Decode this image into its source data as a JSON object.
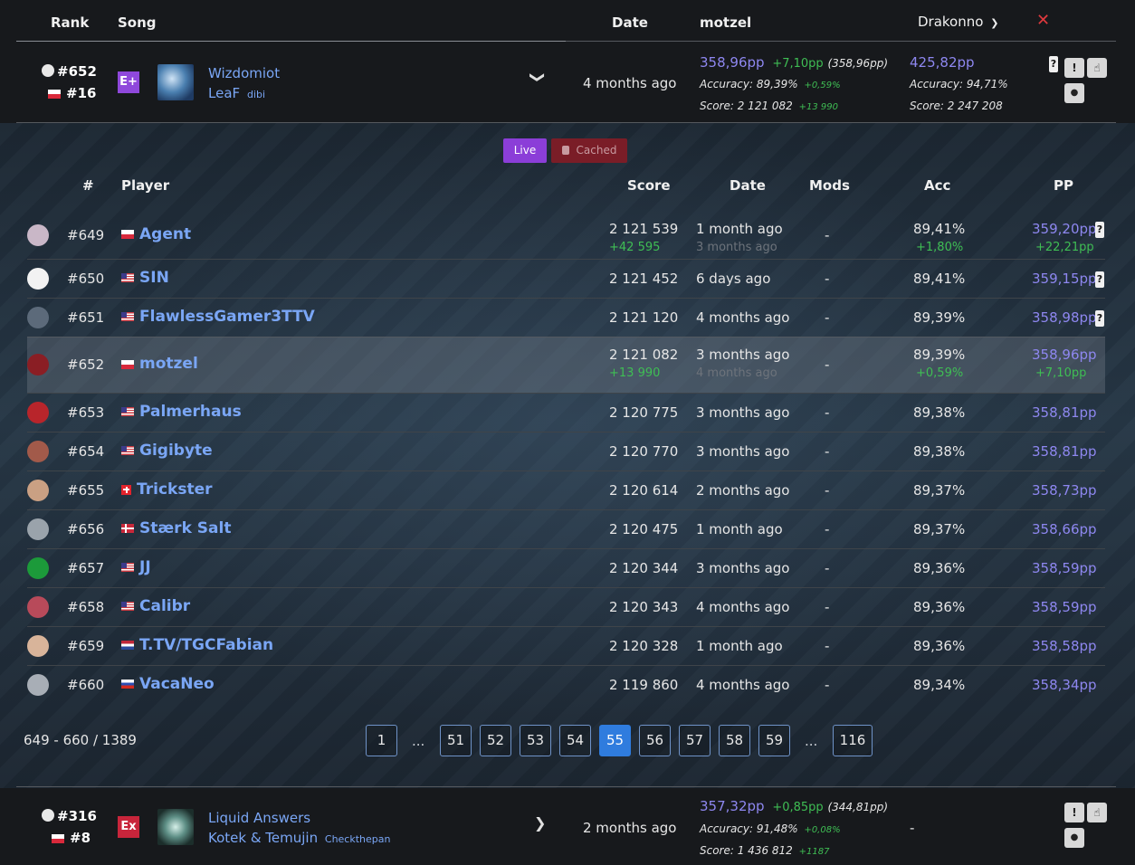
{
  "header": {
    "rank": "Rank",
    "song": "Song",
    "date": "Date",
    "player1": "motzel",
    "player2": "Drakonno",
    "close_icon": "close-x-icon"
  },
  "top_song": {
    "global_rank": "#652",
    "country_rank": "#16",
    "difficulty": "E+",
    "difficulty_color": "#8f48db",
    "title": "Wizdomiot",
    "artist": "LeaF",
    "mapper": "dibi",
    "date": "4 months ago",
    "p1": {
      "pp": "358,96pp",
      "pp_diff": "+7,10pp",
      "pp_prev": "(358,96pp)",
      "accuracy": "Accuracy: 89,39%",
      "acc_diff": "+0,59%",
      "score": "Score: 2 121 082",
      "score_diff": "+13 990"
    },
    "p2": {
      "pp": "425,82pp",
      "accuracy": "Accuracy: 94,71%",
      "score": "Score: 2 247 208"
    }
  },
  "toggle": {
    "live": "Live",
    "cached": "Cached"
  },
  "table": {
    "headers": {
      "num": "#",
      "player": "Player",
      "score": "Score",
      "date": "Date",
      "mods": "Mods",
      "acc": "Acc",
      "pp": "PP"
    },
    "rows": [
      {
        "rank": "#649",
        "flag": "pl",
        "name": "Agent",
        "score": "2 121 539",
        "score_sub": "+42 595",
        "date": "1 month ago",
        "date_sub": "3 months ago",
        "mods": "-",
        "acc": "89,41%",
        "acc_sub": "+1,80%",
        "pp": "359,20pp",
        "pp_sub": "+22,21pp",
        "q": "?"
      },
      {
        "rank": "#650",
        "flag": "us",
        "name": "SIN",
        "score": "2 121 452",
        "date": "6 days ago",
        "mods": "-",
        "acc": "89,41%",
        "pp": "359,15pp",
        "q": "?"
      },
      {
        "rank": "#651",
        "flag": "us",
        "name": "FlawlessGamer3TTV",
        "score": "2 121 120",
        "date": "4 months ago",
        "mods": "-",
        "acc": "89,39%",
        "pp": "358,98pp",
        "q": "?"
      },
      {
        "rank": "#652",
        "flag": "pl",
        "name": "motzel",
        "score": "2 121 082",
        "score_sub": "+13 990",
        "date": "3 months ago",
        "date_sub": "4 months ago",
        "mods": "-",
        "acc": "89,39%",
        "acc_sub": "+0,59%",
        "pp": "358,96pp",
        "pp_sub": "+7,10pp"
      },
      {
        "rank": "#653",
        "flag": "us",
        "name": "Palmerhaus",
        "score": "2 120 775",
        "date": "3 months ago",
        "mods": "-",
        "acc": "89,38%",
        "pp": "358,81pp"
      },
      {
        "rank": "#654",
        "flag": "us",
        "name": "Gigibyte",
        "score": "2 120 770",
        "date": "3 months ago",
        "mods": "-",
        "acc": "89,38%",
        "pp": "358,81pp"
      },
      {
        "rank": "#655",
        "flag": "ch",
        "name": "Trickster",
        "score": "2 120 614",
        "date": "2 months ago",
        "mods": "-",
        "acc": "89,37%",
        "pp": "358,73pp"
      },
      {
        "rank": "#656",
        "flag": "dk",
        "name": "Stærk Salt",
        "score": "2 120 475",
        "date": "1 month ago",
        "mods": "-",
        "acc": "89,37%",
        "pp": "358,66pp"
      },
      {
        "rank": "#657",
        "flag": "us",
        "name": "JJ",
        "score": "2 120 344",
        "date": "3 months ago",
        "mods": "-",
        "acc": "89,36%",
        "pp": "358,59pp"
      },
      {
        "rank": "#658",
        "flag": "us",
        "name": "Calibr",
        "score": "2 120 343",
        "date": "4 months ago",
        "mods": "-",
        "acc": "89,36%",
        "pp": "358,59pp"
      },
      {
        "rank": "#659",
        "flag": "nl",
        "name": "T.TV/TGCFabian",
        "score": "2 120 328",
        "date": "1 month ago",
        "mods": "-",
        "acc": "89,36%",
        "pp": "358,58pp"
      },
      {
        "rank": "#660",
        "flag": "ru",
        "name": "VacaNeo",
        "score": "2 119 860",
        "date": "4 months ago",
        "mods": "-",
        "acc": "89,34%",
        "pp": "358,34pp"
      }
    ]
  },
  "pagination": {
    "range": "649 - 660 / 1389",
    "pages": [
      "1",
      "...",
      "51",
      "52",
      "53",
      "54",
      "55",
      "56",
      "57",
      "58",
      "59",
      "...",
      "116"
    ],
    "active": "55"
  },
  "bottom_song": {
    "global_rank": "#316",
    "country_rank": "#8",
    "difficulty": "Ex",
    "difficulty_color": "#c8253b",
    "title": "Liquid Answers",
    "artist": "Kotek & Temujin",
    "mapper": "Checkthepan",
    "date": "2 months ago",
    "p1": {
      "pp": "357,32pp",
      "pp_diff": "+0,85pp",
      "pp_prev": "(344,81pp)",
      "accuracy": "Accuracy: 91,48%",
      "acc_diff": "+0,08%",
      "score": "Score: 1 436 812",
      "score_diff": "+1187"
    },
    "p2_empty": "-"
  }
}
